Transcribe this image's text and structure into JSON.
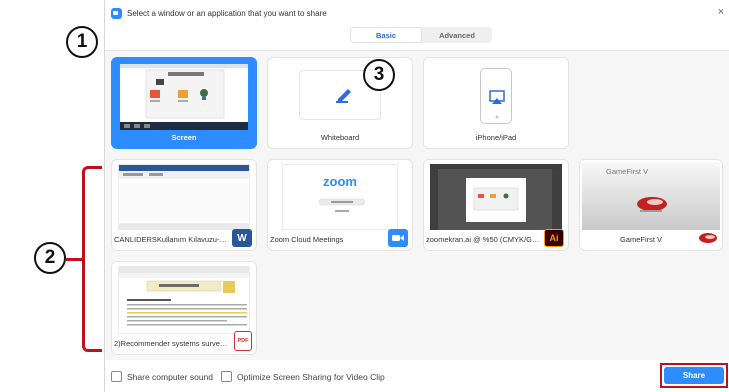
{
  "dialog": {
    "title": "Select a window or an application that you want to share",
    "close_glyph": "×"
  },
  "tabs": [
    {
      "label": "Basic",
      "active": true
    },
    {
      "label": "Advanced",
      "active": false
    }
  ],
  "cards": {
    "screen": "Screen",
    "whiteboard": "Whiteboard",
    "iphone": "iPhone/iPad",
    "word_doc": "CANLIDERSKullanım Kılavuzu-Ak...",
    "zoom_app": "Zoom Cloud Meetings",
    "illustrator": "zoomekran.ai @ %50 (CMYK/GPU...",
    "gamefirst": "GameFirst V",
    "pdf": "2)Recommender systems survey.p..."
  },
  "thumb_text": {
    "zoom_logo": "zoom",
    "gamefirst_title": "GameFirst V",
    "word_badge": "W",
    "ai_badge": "Ai",
    "pdf_badge": "PDF"
  },
  "bottom": {
    "share_sound": "Share computer sound",
    "optimize": "Optimize Screen Sharing for Video Clip",
    "share_button": "Share"
  },
  "annotations": {
    "one": "1",
    "two": "2",
    "three": "3"
  },
  "colors": {
    "accent": "#2d8cff",
    "annotation_red": "#c0101a"
  },
  "icons": [
    "app-icon",
    "close-icon",
    "pen-icon",
    "airplay-icon",
    "word-icon",
    "zoom-camera-icon",
    "illustrator-icon",
    "gamefirst-icon",
    "pdf-icon"
  ]
}
